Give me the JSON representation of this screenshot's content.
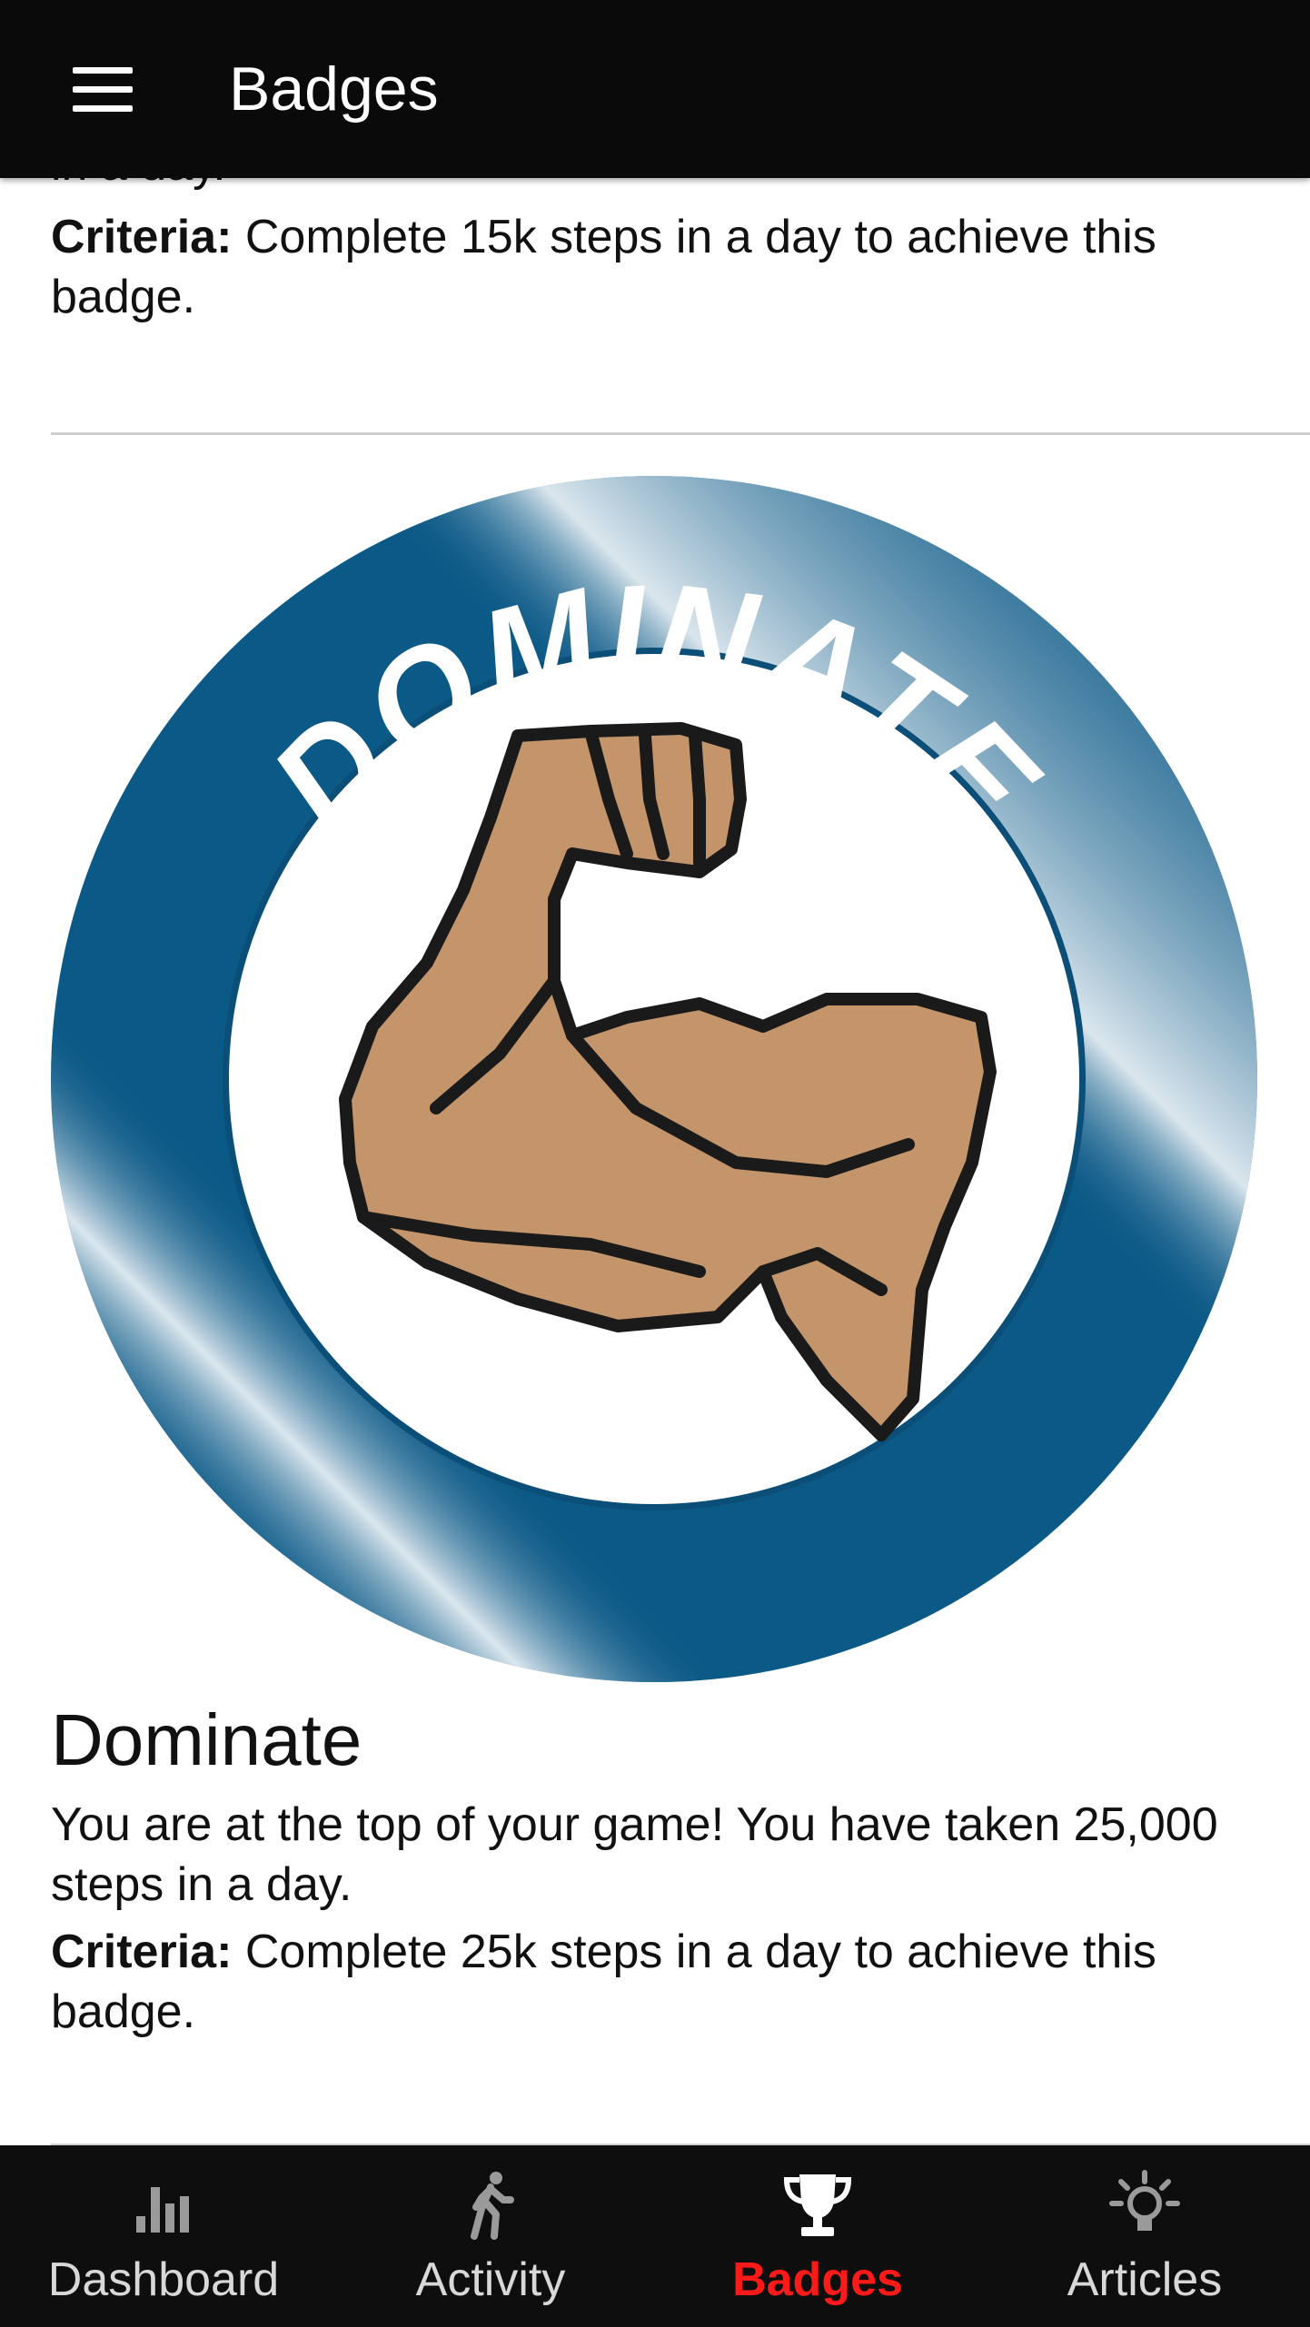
{
  "app_bar": {
    "title": "Badges",
    "menu_icon": "hamburger-menu-icon"
  },
  "previous_badge": {
    "clipped_description_line": "in a day.",
    "criteria_label": "Criteria:",
    "criteria_text": " Complete 15k steps in a day to achieve this badge."
  },
  "badge": {
    "image_text": "DOMINATE",
    "image_icon": "flexed-bicep-icon",
    "title": "Dominate",
    "description": "You are at the top of your game! You have taken 25,000 steps in a day.",
    "criteria_label": "Criteria:",
    "criteria_text": " Complete 25k steps in a day to achieve this badge."
  },
  "bottom_nav": {
    "items": [
      {
        "label": "Dashboard",
        "icon": "bar-chart-icon",
        "active": false
      },
      {
        "label": "Activity",
        "icon": "walking-person-icon",
        "active": false
      },
      {
        "label": "Badges",
        "icon": "trophy-icon",
        "active": true
      },
      {
        "label": "Articles",
        "icon": "lightbulb-icon",
        "active": false
      }
    ]
  },
  "colors": {
    "app_bar_bg": "#0a0a0a",
    "nav_bg": "#0e0e0e",
    "active_nav": "#ff1a1a",
    "inactive_nav": "#d8d8d8",
    "badge_ring_blue": "#0b5987",
    "arm_skin": "#c4956a"
  }
}
